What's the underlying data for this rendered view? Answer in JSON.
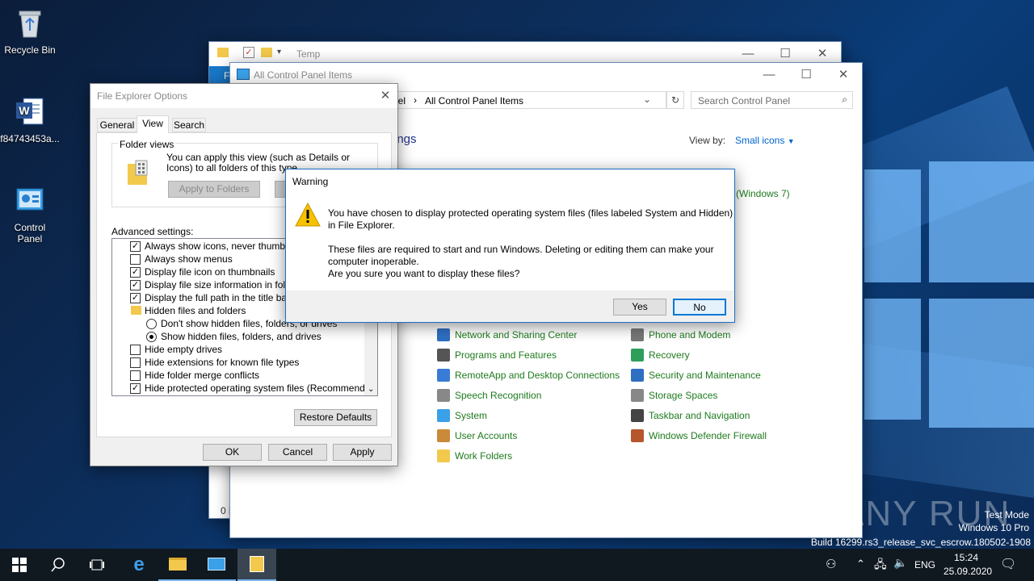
{
  "desktop": {
    "icons": [
      {
        "label": "Recycle Bin"
      },
      {
        "label": "f84743453a..."
      },
      {
        "label": "Control\nPanel"
      }
    ],
    "watermark": {
      "brand": "ANY RUN",
      "line1": "Test Mode",
      "line2": "Windows 10 Pro",
      "line3": "Build 16299.rs3_release_svc_escrow.180502-1908"
    }
  },
  "explorer_window": {
    "title": "Temp",
    "status_fragment": "0 i",
    "ribbon_tab": "F"
  },
  "control_panel": {
    "title": "All Control Panel Items",
    "address_prefix": "nel",
    "address": "All Control Panel Items",
    "search_placeholder": "Search Control Panel",
    "heading_fragment": "ings",
    "view_by_label": "View by:",
    "view_by_value": "Small icons",
    "windows7_fragment": "(Windows 7)",
    "items_left": [
      {
        "label": "Network and Sharing Center",
        "icon": "network-icon"
      },
      {
        "label": "Programs and Features",
        "icon": "programs-icon"
      },
      {
        "label": "RemoteApp and Desktop Connections",
        "icon": "remoteapp-icon"
      },
      {
        "label": "Speech Recognition",
        "icon": "microphone-icon"
      },
      {
        "label": "System",
        "icon": "system-icon"
      },
      {
        "label": "User Accounts",
        "icon": "users-icon"
      },
      {
        "label": "Work Folders",
        "icon": "folder-icon"
      }
    ],
    "items_right": [
      {
        "label": "Phone and Modem",
        "icon": "phone-icon"
      },
      {
        "label": "Recovery",
        "icon": "recovery-icon"
      },
      {
        "label": "Security and Maintenance",
        "icon": "flag-icon"
      },
      {
        "label": "Storage Spaces",
        "icon": "storage-icon"
      },
      {
        "label": "Taskbar and Navigation",
        "icon": "taskbar-icon"
      },
      {
        "label": "Windows Defender Firewall",
        "icon": "firewall-icon"
      }
    ]
  },
  "folder_options": {
    "title": "File Explorer Options",
    "tabs": [
      "General",
      "View",
      "Search"
    ],
    "folder_views_label": "Folder views",
    "folder_views_text": "You can apply this view (such as Details or Icons) to all folders of this type.",
    "apply_to_folders": "Apply to Folders",
    "advanced_label": "Advanced settings:",
    "advanced_items": [
      {
        "label": "Always show icons, never thumbnails",
        "type": "check",
        "checked": true
      },
      {
        "label": "Always show menus",
        "type": "check",
        "checked": false
      },
      {
        "label": "Display file icon on thumbnails",
        "type": "check",
        "checked": true
      },
      {
        "label": "Display file size information in folder ti",
        "type": "check",
        "checked": true
      },
      {
        "label": "Display the full path in the title bar",
        "type": "check",
        "checked": true
      },
      {
        "label": "Hidden files and folders",
        "type": "folder",
        "checked": false
      },
      {
        "label": "Don't show hidden files, folders, or drives",
        "type": "radio",
        "checked": false
      },
      {
        "label": "Show hidden files, folders, and drives",
        "type": "radio",
        "checked": true
      },
      {
        "label": "Hide empty drives",
        "type": "check",
        "checked": false
      },
      {
        "label": "Hide extensions for known file types",
        "type": "check",
        "checked": false
      },
      {
        "label": "Hide folder merge conflicts",
        "type": "check",
        "checked": false
      },
      {
        "label": "Hide protected operating system files (Recommended)",
        "type": "check",
        "checked": true
      }
    ],
    "restore_defaults": "Restore Defaults",
    "ok": "OK",
    "cancel": "Cancel",
    "apply": "Apply"
  },
  "warning": {
    "title": "Warning",
    "line1": "You have chosen to display protected operating system files (files labeled System and Hidden)",
    "line2": "in File Explorer.",
    "line3": "These files are required to start and run Windows. Deleting or editing them can make your",
    "line4": "computer inoperable.",
    "line5": "Are you sure you want to display these files?",
    "yes": "Yes",
    "no": "No"
  },
  "taskbar": {
    "language": "ENG",
    "time": "15:24",
    "date": "25.09.2020"
  },
  "colors": {
    "link": "#1e7b1e",
    "accent": "#0078d7",
    "taskbar": "#101820"
  }
}
